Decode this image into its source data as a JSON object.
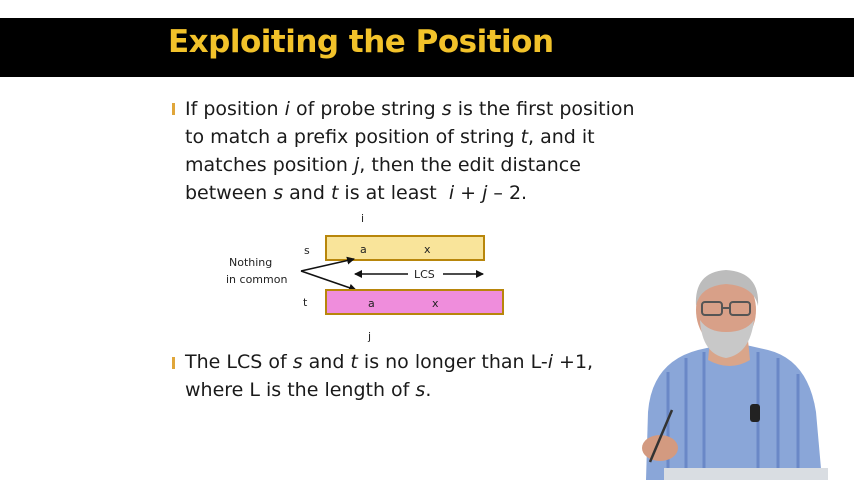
{
  "slide": {
    "title": "Exploiting the Position",
    "accent_color": "#f2c22a",
    "bullet1": {
      "line1": {
        "t1": "If position ",
        "i": "i",
        "t2": " of probe string ",
        "s": "s",
        "t3": " is the first position"
      },
      "line2": {
        "t1": "to match a prefix position of string ",
        "t": "t",
        "t2": ", and it"
      },
      "line3": {
        "t1": "matches position ",
        "j": "j",
        "t2": ", then the edit distance"
      },
      "line4": {
        "t1": "between ",
        "s": "s",
        "t2": " and ",
        "t": "t",
        "t3": " is at least  ",
        "i": "i",
        "t4": " + ",
        "j": "j",
        "t5": " – 2."
      }
    },
    "bullet2": {
      "line1": {
        "t1": "The LCS of ",
        "s": "s",
        "t2": " and ",
        "t": "t",
        "t3": " is no longer than L-",
        "i": "i",
        "t4": " +1,"
      },
      "line2": {
        "t1": "where L is the length of ",
        "s": "s",
        "t2": "."
      }
    }
  },
  "diagram": {
    "label_i": "i",
    "label_j": "j",
    "label_s": "s",
    "label_t": "t",
    "nothing_line1": "Nothing",
    "nothing_line2": "in common",
    "s_bar": {
      "a": "a",
      "x": "x",
      "color": "#f9e49a"
    },
    "t_bar": {
      "a": "a",
      "x": "x",
      "color": "#ef8ddc"
    },
    "lcs_label": "LCS"
  }
}
